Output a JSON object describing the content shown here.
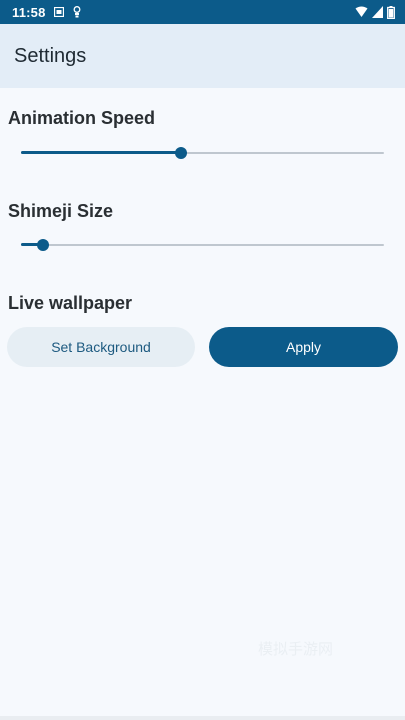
{
  "status_bar": {
    "time": "11:58",
    "left_icons": [
      "notification-photo-icon",
      "notification-usb-icon"
    ],
    "right_icons": [
      "wifi-icon",
      "signal-icon",
      "battery-icon"
    ]
  },
  "app_bar": {
    "title": "Settings"
  },
  "animation_speed": {
    "label": "Animation Speed",
    "value": 0.44
  },
  "shimeji_size": {
    "label": "Shimeji Size",
    "value": 0.06
  },
  "live_wallpaper": {
    "label": "Live wallpaper",
    "set_background_label": "Set Background",
    "apply_label": "Apply"
  },
  "watermark": {
    "text": "模拟手游网"
  },
  "colors": {
    "accent": "#0c5b8a",
    "app_bar_bg": "#e3edf7",
    "page_bg": "#f6f9fd",
    "secondary_button_bg": "#e6eef4"
  }
}
